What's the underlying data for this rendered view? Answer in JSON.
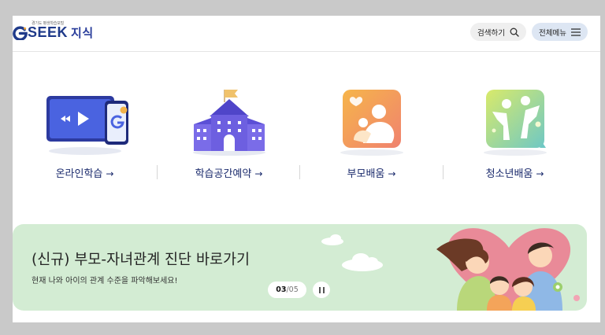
{
  "header": {
    "logo_sub": "경기도 평생학습포털",
    "logo_main": "SEEK",
    "logo_suffix": "지식",
    "search_label": "검색하기",
    "menu_label": "전체메뉴"
  },
  "quick_menu": [
    {
      "label": "온라인학습",
      "arrow": "→"
    },
    {
      "label": "학습공간예약",
      "arrow": "→"
    },
    {
      "label": "부모배움",
      "arrow": "→"
    },
    {
      "label": "청소년배움",
      "arrow": "→"
    }
  ],
  "banner": {
    "title": "(신규) 부모-자녀관계 진단 바로가기",
    "subtitle": "현재 나와 아이의 관계 수준을 파악해보세요!",
    "page_current": "03",
    "page_total": "/05"
  },
  "colors": {
    "brand": "#1f3a8a",
    "banner_bg": "#d3ecd3",
    "menu_btn_bg": "#dde6f3"
  }
}
